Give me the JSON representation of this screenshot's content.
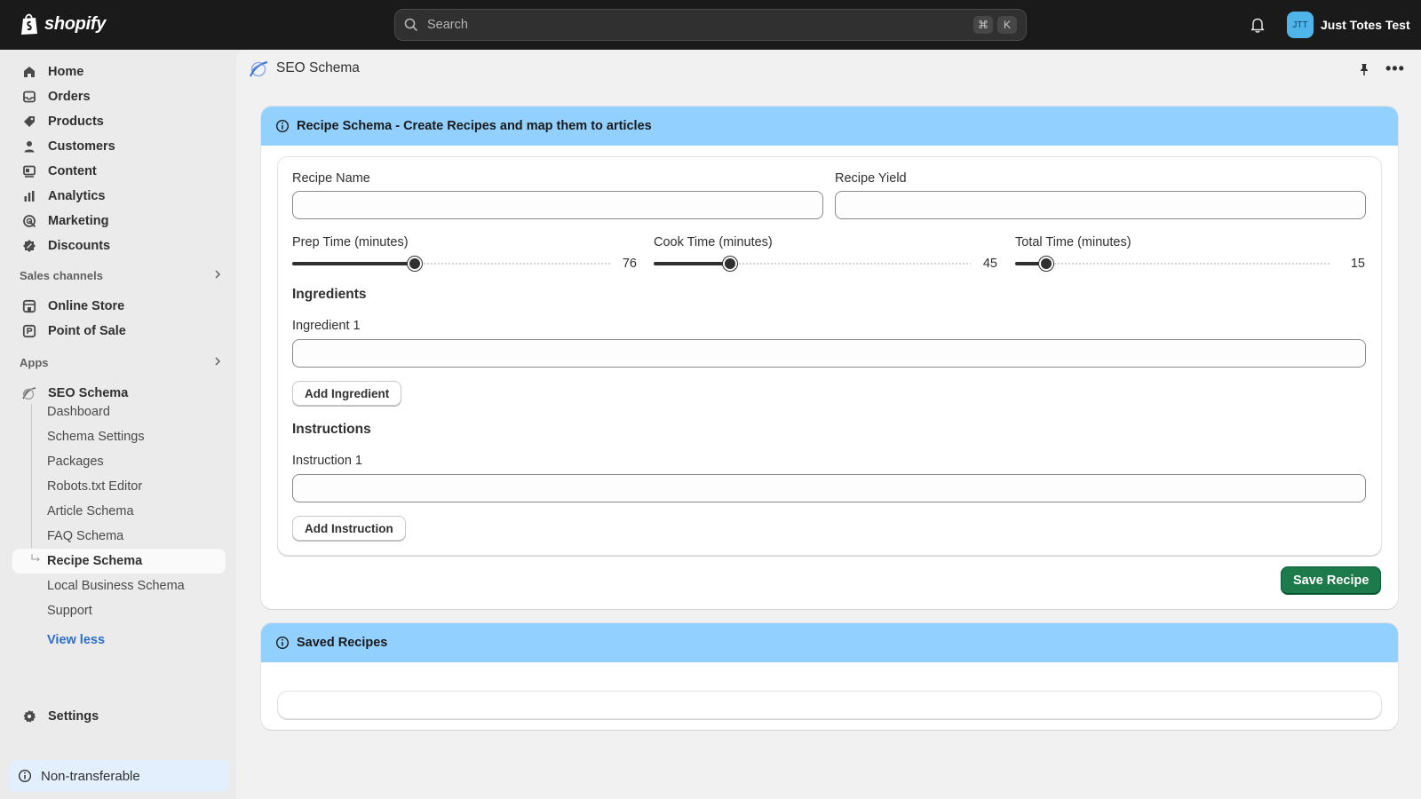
{
  "topbar": {
    "brand": "shopify",
    "search_placeholder": "Search",
    "shortcut_keys": [
      "⌘",
      "K"
    ],
    "account_initials": "JTT",
    "account_name": "Just Totes Test"
  },
  "sidebar": {
    "main_items": [
      {
        "label": "Home",
        "icon": "home-icon"
      },
      {
        "label": "Orders",
        "icon": "inbox-icon"
      },
      {
        "label": "Products",
        "icon": "tag-icon"
      },
      {
        "label": "Customers",
        "icon": "person-icon"
      },
      {
        "label": "Content",
        "icon": "content-icon"
      },
      {
        "label": "Analytics",
        "icon": "bar-chart-icon"
      },
      {
        "label": "Marketing",
        "icon": "target-icon"
      },
      {
        "label": "Discounts",
        "icon": "discount-icon"
      }
    ],
    "sales_channels_title": "Sales channels",
    "sales_channels": [
      {
        "label": "Online Store",
        "icon": "store-icon"
      },
      {
        "label": "Point of Sale",
        "icon": "pos-icon"
      }
    ],
    "apps_title": "Apps",
    "app_name": "SEO Schema",
    "app_sub_items": [
      "Dashboard",
      "Schema Settings",
      "Packages",
      "Robots.txt Editor",
      "Article Schema",
      "FAQ Schema",
      "Recipe Schema",
      "Local Business Schema",
      "Support"
    ],
    "active_sub_item": "Recipe Schema",
    "view_less": "View less",
    "settings": "Settings",
    "non_transferable": "Non-transferable"
  },
  "page": {
    "title": "SEO Schema"
  },
  "recipe_card": {
    "header": "Recipe Schema - Create Recipes and map them to articles",
    "recipe_name_label": "Recipe Name",
    "recipe_name_value": "",
    "recipe_yield_label": "Recipe Yield",
    "recipe_yield_value": "",
    "prep_time_label": "Prep Time (minutes)",
    "prep_time_value": 76,
    "cook_time_label": "Cook Time (minutes)",
    "cook_time_value": 45,
    "total_time_label": "Total Time (minutes)",
    "total_time_value": 15,
    "slider_fill_fraction": {
      "prep": 0.385,
      "cook": 0.24,
      "total": 0.097
    },
    "ingredients_heading": "Ingredients",
    "ingredient_1_label": "Ingredient 1",
    "ingredient_1_value": "",
    "add_ingredient": "Add Ingredient",
    "instructions_heading": "Instructions",
    "instruction_1_label": "Instruction 1",
    "instruction_1_value": "",
    "add_instruction": "Add Instruction",
    "save_recipe": "Save Recipe"
  },
  "saved_card": {
    "header": "Saved Recipes"
  },
  "colors": {
    "banner": "#91d0ff",
    "primary_button": "#1d7a4b",
    "topbar": "#1a1a1a"
  }
}
